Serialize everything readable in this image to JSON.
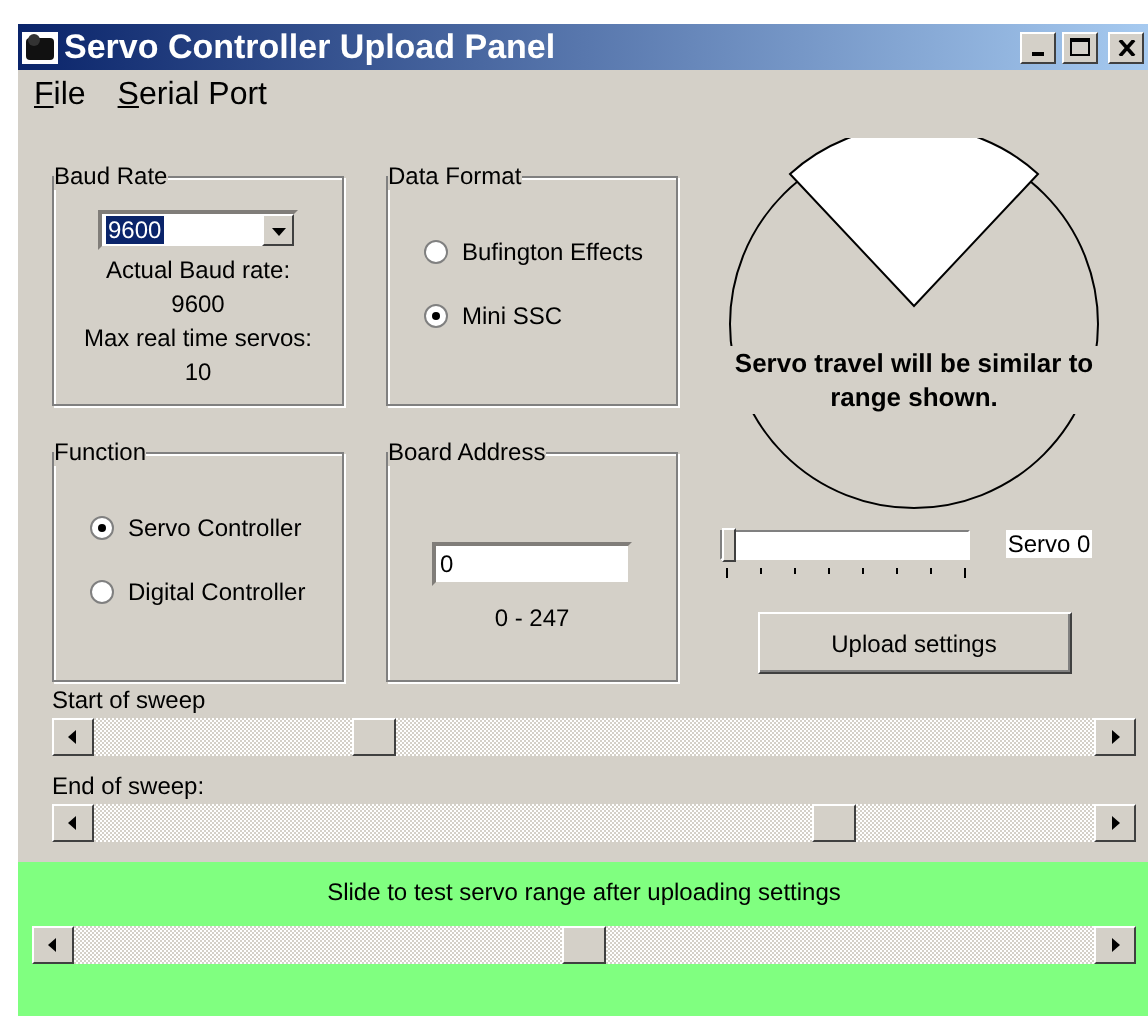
{
  "window": {
    "title": "Servo Controller Upload Panel"
  },
  "menu": [
    "File",
    "Serial Port"
  ],
  "baud_rate": {
    "title": "Baud Rate",
    "value": "9600",
    "actual_label": "Actual Baud rate:",
    "actual_value": "9600",
    "max_label": "Max real time servos:",
    "max_value": "10"
  },
  "data_format": {
    "title": "Data Format",
    "options": [
      {
        "label": "Bufington Effects",
        "selected": false
      },
      {
        "label": "Mini SSC",
        "selected": true
      }
    ]
  },
  "function": {
    "title": "Function",
    "options": [
      {
        "label": "Servo Controller",
        "selected": true
      },
      {
        "label": "Digital Controller",
        "selected": false
      }
    ]
  },
  "board_address": {
    "title": "Board Address",
    "value": "0",
    "range": "0 - 247"
  },
  "range_preview": {
    "caption": "Servo travel will be similar to range shown."
  },
  "servo_slider": {
    "level": 0,
    "label": "Servo 0"
  },
  "upload_button": "Upload settings",
  "start_sweep": {
    "label": "Start of sweep",
    "level": 0.27
  },
  "end_sweep": {
    "label": "End of sweep:",
    "level": 0.75
  },
  "test_panel": {
    "caption": "Slide to test servo range after uploading settings",
    "level": 0.5
  }
}
